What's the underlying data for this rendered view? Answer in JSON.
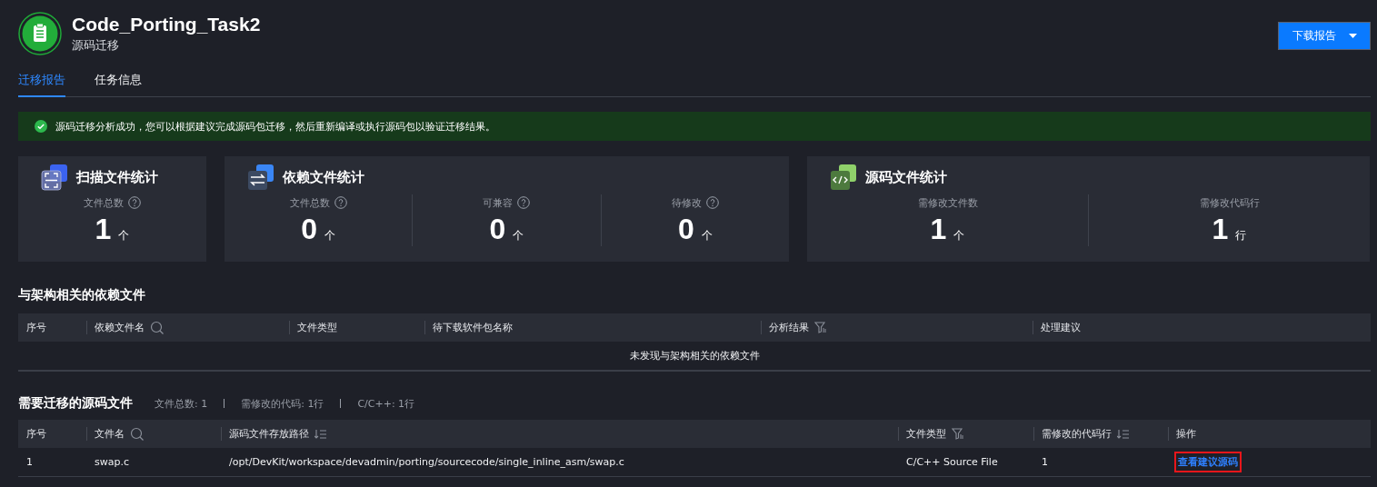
{
  "header": {
    "title": "Code_Porting_Task2",
    "subtitle": "源码迁移",
    "download_button": "下载报告"
  },
  "tabs": [
    {
      "label": "迁移报告",
      "selected": true
    },
    {
      "label": "任务信息",
      "selected": false
    }
  ],
  "alert": {
    "kind": "success",
    "message": "源码迁移分析成功，您可以根据建议完成源码包迁移，然后重新编译或执行源码包以验证迁移结果。"
  },
  "cards": [
    {
      "kind": "scan",
      "title": "扫描文件统计",
      "stats": [
        {
          "label": "文件总数",
          "help": true,
          "value": "1",
          "unit": "个"
        }
      ]
    },
    {
      "kind": "swap",
      "title": "依赖文件统计",
      "stats": [
        {
          "label": "文件总数",
          "help": true,
          "value": "0",
          "unit": "个"
        },
        {
          "label": "可兼容",
          "help": true,
          "value": "0",
          "unit": "个"
        },
        {
          "label": "待修改",
          "help": true,
          "value": "0",
          "unit": "个"
        }
      ]
    },
    {
      "kind": "code",
      "title": "源码文件统计",
      "stats": [
        {
          "label": "需修改文件数",
          "help": false,
          "value": "1",
          "unit": "个"
        },
        {
          "label": "需修改代码行",
          "help": false,
          "value": "1",
          "unit": "行"
        }
      ]
    }
  ],
  "dependency_section": {
    "title": "与架构相关的依赖文件",
    "columns": [
      {
        "label": "序号",
        "kind": "plain"
      },
      {
        "label": "依赖文件名",
        "kind": "search"
      },
      {
        "label": "文件类型",
        "kind": "plain"
      },
      {
        "label": "待下载软件包名称",
        "kind": "plain"
      },
      {
        "label": "分析结果",
        "kind": "filter"
      },
      {
        "label": "处理建议",
        "kind": "plain"
      }
    ],
    "empty_message": "未发现与架构相关的依赖文件"
  },
  "source_section": {
    "title": "需要迁移的源码文件",
    "summary": [
      "文件总数:  1",
      "需修改的代码: 1行",
      "C/C++: 1行"
    ],
    "columns": [
      {
        "label": "序号",
        "kind": "plain"
      },
      {
        "label": "文件名",
        "kind": "search"
      },
      {
        "label": "源码文件存放路径",
        "kind": "sort"
      },
      {
        "label": "文件类型",
        "kind": "filter"
      },
      {
        "label": "需修改的代码行",
        "kind": "sort"
      },
      {
        "label": "操作",
        "kind": "plain"
      }
    ],
    "rows": [
      {
        "cells": [
          "1",
          "swap.c",
          "/opt/DevKit/workspace/devadmin/porting/sourcecode/single_inline_asm/swap.c",
          "C/C++ Source File",
          "1"
        ],
        "action": "查看建议源码",
        "highlighted": true
      }
    ]
  }
}
